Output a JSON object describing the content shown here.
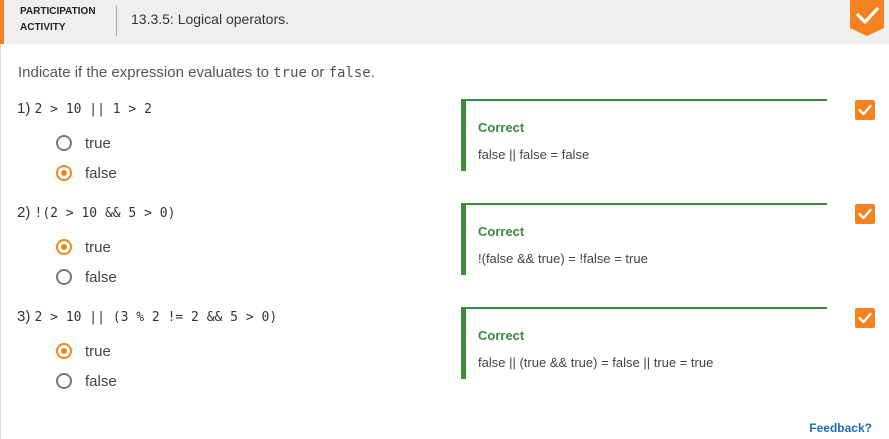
{
  "header": {
    "participation_label_line1": "PARTICIPATION",
    "participation_label_line2": "ACTIVITY",
    "activity_title": "13.3.5: Logical operators.",
    "accent_color": "#f5821f"
  },
  "instruction": {
    "prefix": "Indicate if the expression evaluates to ",
    "true_word": "true",
    "middle": " or ",
    "false_word": "false",
    "suffix": "."
  },
  "questions": [
    {
      "number": "1)",
      "expression": "2 > 10 || 1 > 2",
      "choices": [
        {
          "label": "true",
          "selected": false
        },
        {
          "label": "false",
          "selected": true
        }
      ],
      "feedback_title": "Correct",
      "feedback_text": "false || false = false"
    },
    {
      "number": "2)",
      "expression": "!(2 > 10 && 5 > 0)",
      "choices": [
        {
          "label": "true",
          "selected": true
        },
        {
          "label": "false",
          "selected": false
        }
      ],
      "feedback_title": "Correct",
      "feedback_text": "!(false && true) = !false = true"
    },
    {
      "number": "3)",
      "expression": "2 > 10 || (3 % 2 != 2 && 5 > 0)",
      "choices": [
        {
          "label": "true",
          "selected": true
        },
        {
          "label": "false",
          "selected": false
        }
      ],
      "feedback_title": "Correct",
      "feedback_text": "false || (true && true) = false || true = true"
    }
  ],
  "feedback_link": "Feedback?",
  "colors": {
    "correct_green": "#3c8a3a",
    "link_blue": "#1a6fb5",
    "check_orange": "#f5821f"
  },
  "icons": {
    "header_check": "checkmark-badge-icon",
    "question_check": "checkmark-icon"
  }
}
